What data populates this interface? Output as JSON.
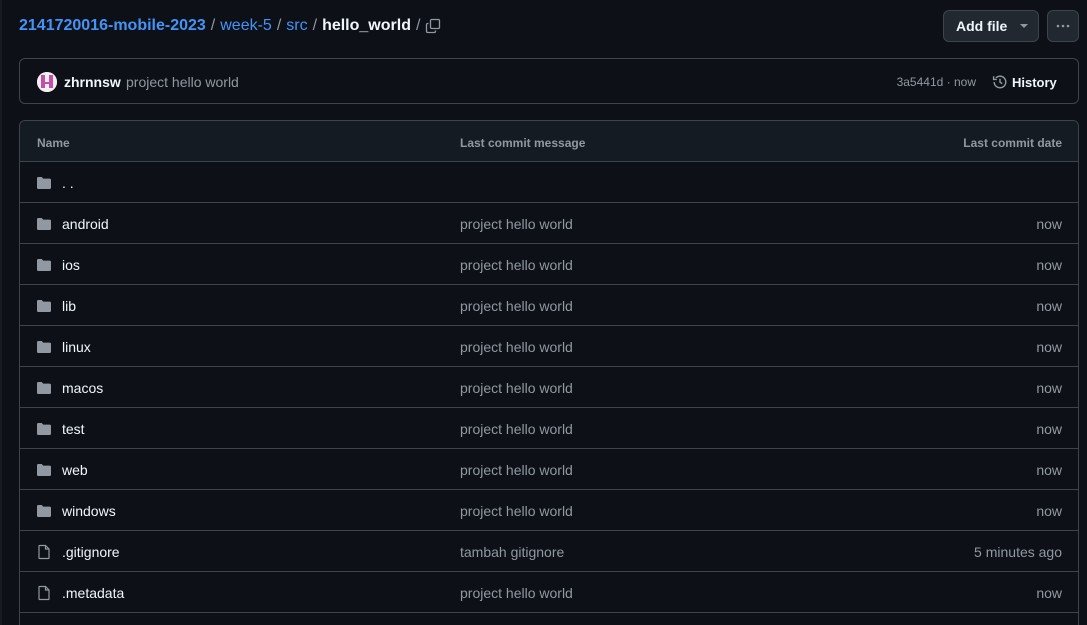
{
  "breadcrumb": {
    "repo": "2141720016-mobile-2023",
    "folder1": "week-5",
    "folder2": "src",
    "current": "hello_world",
    "separator": "/"
  },
  "actions": {
    "add_file_label": "Add file",
    "more_label": "···"
  },
  "commit": {
    "author": "zhrnnsw",
    "message": "project hello world",
    "sha": "3a5441d",
    "meta_separator": "·",
    "time": "now",
    "history_label": "History"
  },
  "table": {
    "headers": {
      "name": "Name",
      "message": "Last commit message",
      "date": "Last commit date"
    },
    "parent_row": {
      "name": ". ."
    },
    "rows": [
      {
        "type": "folder",
        "name": "android",
        "message": "project hello world",
        "date": "now"
      },
      {
        "type": "folder",
        "name": "ios",
        "message": "project hello world",
        "date": "now"
      },
      {
        "type": "folder",
        "name": "lib",
        "message": "project hello world",
        "date": "now"
      },
      {
        "type": "folder",
        "name": "linux",
        "message": "project hello world",
        "date": "now"
      },
      {
        "type": "folder",
        "name": "macos",
        "message": "project hello world",
        "date": "now"
      },
      {
        "type": "folder",
        "name": "test",
        "message": "project hello world",
        "date": "now"
      },
      {
        "type": "folder",
        "name": "web",
        "message": "project hello world",
        "date": "now"
      },
      {
        "type": "folder",
        "name": "windows",
        "message": "project hello world",
        "date": "now"
      },
      {
        "type": "file",
        "name": ".gitignore",
        "message": "tambah gitignore",
        "date": "5 minutes ago"
      },
      {
        "type": "file",
        "name": ".metadata",
        "message": "project hello world",
        "date": "now"
      }
    ]
  },
  "colors": {
    "background": "#0d1117",
    "link": "#4493f8",
    "border": "#3d444d",
    "muted": "#9198a1",
    "folder_icon": "#9198a1"
  },
  "icons": {
    "copy": "copy-icon",
    "history": "history-icon",
    "folder": "folder-icon",
    "file": "file-icon",
    "caret": "triangle-down-icon",
    "more": "kebab-horizontal-icon"
  }
}
